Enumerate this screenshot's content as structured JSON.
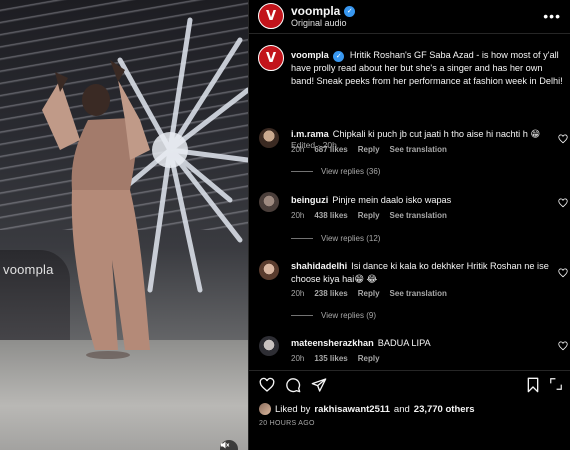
{
  "media": {
    "watermark": "voompla"
  },
  "header": {
    "username": "voompla",
    "audio": "Original audio",
    "avatar_letter": "V"
  },
  "caption": {
    "username": "voompla",
    "text": "Hritik Roshan's GF Saba Azad - is how most of y'all have prolly read about her but she's a singer and has her own band! Sneak peeks from her performance at fashion week in Delhi!",
    "meta": "Edited · 20h"
  },
  "comments": [
    {
      "username": "i.m.rama",
      "text": "Chipkali ki puch jb cut jaati h tho aise hi nachti h 😁",
      "time": "20h",
      "likes": "687 likes",
      "reply": "Reply",
      "translate": "See translation",
      "view_replies": "View replies (36)"
    },
    {
      "username": "beinguzi",
      "text": "Pinjre mein daalo isko wapas",
      "time": "20h",
      "likes": "438 likes",
      "reply": "Reply",
      "translate": "See translation",
      "view_replies": "View replies (12)"
    },
    {
      "username": "shahidadelhi",
      "text": "Isi dance ki kala ko dekhker Hritik Roshan ne ise choose kiya hai😁 😂",
      "time": "20h",
      "likes": "238 likes",
      "reply": "Reply",
      "translate": "See translation",
      "view_replies": "View replies (9)"
    },
    {
      "username": "mateensherazkhan",
      "text": "BADUA LIPA",
      "time": "20h",
      "likes": "135 likes",
      "reply": "Reply"
    }
  ],
  "liked_by": {
    "prefix": "Liked by",
    "user": "rakhisawant2511",
    "mid": "and",
    "others": "23,770 others"
  },
  "timestamp": "20 HOURS AGO",
  "colors": {
    "brand_red": "#c2141b",
    "verified_blue": "#3897f0",
    "muted_text": "#a8a8a8"
  }
}
